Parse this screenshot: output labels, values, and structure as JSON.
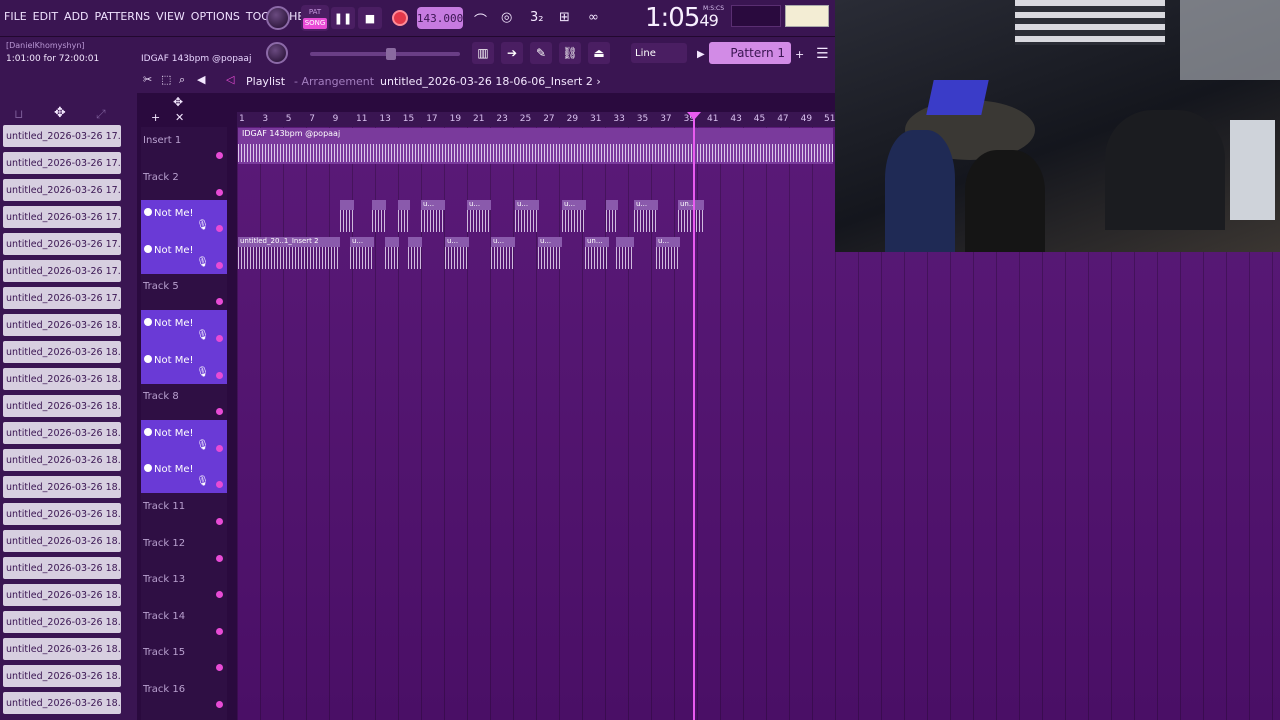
{
  "menu": [
    "FILE",
    "EDIT",
    "ADD",
    "PATTERNS",
    "VIEW",
    "OPTIONS",
    "TOOLS",
    "HELP"
  ],
  "transport": {
    "pat": "PAT",
    "song": "SONG",
    "tempo": "143.000",
    "time_main": "1:05",
    "time_sub": "49",
    "time_unit": "M:S:CS"
  },
  "info": {
    "user": "[DanielKhomyshyn]",
    "range": "1:01:00 for 72:00:01",
    "project": "IDGAF 143bpm @popaaj"
  },
  "snap": {
    "mode": "Line"
  },
  "pattern": {
    "label": "Pattern 1"
  },
  "playlist": {
    "title": "Playlist",
    "separator": "-",
    "sub": "Arrangement",
    "file": "untitled_2026-03-26 18-06-06_Insert 2 ›"
  },
  "browser": {
    "items": [
      "untitled_2026-03-26 17...",
      "untitled_2026-03-26 17...",
      "untitled_2026-03-26 17...",
      "untitled_2026-03-26 17...",
      "untitled_2026-03-26 17...",
      "untitled_2026-03-26 17...",
      "untitled_2026-03-26 17...",
      "untitled_2026-03-26 18...",
      "untitled_2026-03-26 18...",
      "untitled_2026-03-26 18...",
      "untitled_2026-03-26 18...",
      "untitled_2026-03-26 18...",
      "untitled_2026-03-26 18...",
      "untitled_2026-03-26 18...",
      "untitled_2026-03-26 18...",
      "untitled_2026-03-26 18...",
      "untitled_2026-03-26 18...",
      "untitled_2026-03-26 18...",
      "untitled_2026-03-26 18...",
      "untitled_2026-03-26 18...",
      "untitled_2026-03-26 18...",
      "untitled_2026-03-26 18..."
    ]
  },
  "tracks": [
    {
      "name": "Insert 1",
      "active": false
    },
    {
      "name": "Track 2",
      "active": false
    },
    {
      "name": "Not Me!",
      "active": true
    },
    {
      "name": "Not Me!",
      "active": true
    },
    {
      "name": "Track 5",
      "active": false
    },
    {
      "name": "Not Me!",
      "active": true
    },
    {
      "name": "Not Me!",
      "active": true
    },
    {
      "name": "Track 8",
      "active": false
    },
    {
      "name": "Not Me!",
      "active": true
    },
    {
      "name": "Not Me!",
      "active": true
    },
    {
      "name": "Track 11",
      "active": false
    },
    {
      "name": "Track 12",
      "active": false
    },
    {
      "name": "Track 13",
      "active": false
    },
    {
      "name": "Track 14",
      "active": false
    },
    {
      "name": "Track 15",
      "active": false
    },
    {
      "name": "Track 16",
      "active": false
    }
  ],
  "ruler": [
    "1",
    "3",
    "5",
    "7",
    "9",
    "11",
    "13",
    "15",
    "17",
    "19",
    "21",
    "23",
    "25",
    "27",
    "29",
    "31",
    "33",
    "35",
    "37",
    "39",
    "41",
    "43",
    "45",
    "47",
    "49",
    "51"
  ],
  "clips": {
    "top": "IDGAF 143bpm @popaaj",
    "insert2": "untitled_20..1_Insert 2",
    "short": "u...",
    "un": "un..."
  }
}
